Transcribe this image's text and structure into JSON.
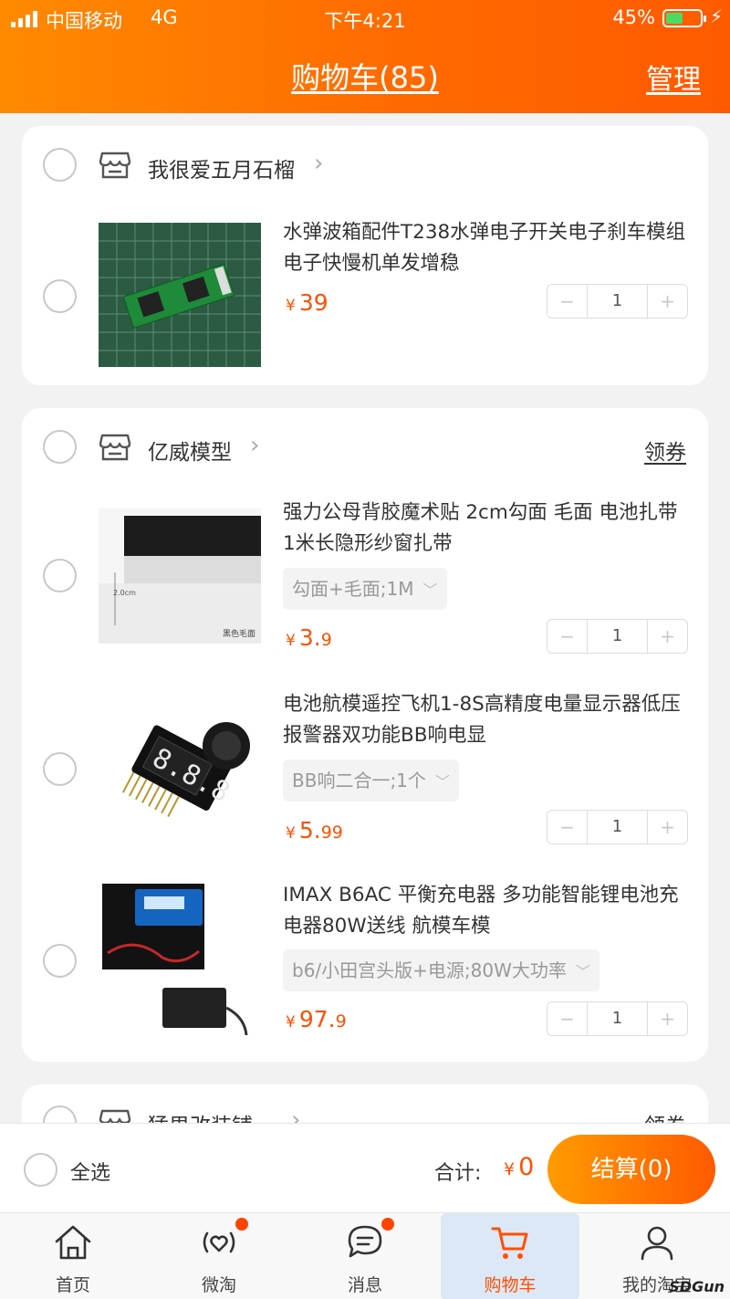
{
  "status_bar": {
    "carrier": "中国移动",
    "network": "4G",
    "time": "下午4:21",
    "battery": "45%"
  },
  "header": {
    "title": "购物车(85)",
    "manage": "管理"
  },
  "stores": [
    {
      "name": "我很爱五月石榴",
      "coupon": "",
      "items": [
        {
          "title": "水弹波箱配件T238水弹电子开关电子刹车模组电子快慢机单发增稳",
          "sku": "",
          "price_currency": "¥",
          "price_int": "39",
          "price_dec": "",
          "qty": "1"
        }
      ]
    },
    {
      "name": "亿威模型",
      "coupon": "领券",
      "items": [
        {
          "title": "强力公母背胶魔术贴 2cm勾面 毛面 电池扎带 1米长隐形纱窗扎带",
          "sku": "勾面+毛面;1M",
          "price_currency": "¥",
          "price_int": "3.",
          "price_dec": "9",
          "qty": "1",
          "thumb_caption_1": "2.0cm",
          "thumb_caption_2": "黑色毛面"
        },
        {
          "title": "电池航模遥控飞机1-8S高精度电量显示器低压报警器双功能BB响电显",
          "sku": "BB响二合一;1个",
          "price_currency": "¥",
          "price_int": "5.",
          "price_dec": "99",
          "qty": "1",
          "thumb_digits": "8.8.8"
        },
        {
          "title": "IMAX B6AC 平衡充电器 多功能智能锂电池充电器80W送线 航模车模",
          "sku": "b6/小田宫头版+电源;80W大功率",
          "price_currency": "¥",
          "price_int": "97.",
          "price_dec": "9",
          "qty": "1"
        }
      ]
    },
    {
      "name": "猛男改装铺",
      "coupon": "领券"
    }
  ],
  "stepper": {
    "minus": "−",
    "plus": "+"
  },
  "checkout": {
    "select_all": "全选",
    "total_label": "合计:",
    "total_currency": "¥",
    "total_value": "0",
    "pay_button": "结算(0)"
  },
  "tabs": [
    {
      "label": "首页",
      "icon": "home-icon"
    },
    {
      "label": "微淘",
      "icon": "heart-signal-icon"
    },
    {
      "label": "消息",
      "icon": "message-icon"
    },
    {
      "label": "购物车",
      "icon": "cart-icon"
    },
    {
      "label": "我的淘宝",
      "icon": "profile-icon"
    }
  ],
  "watermark": "SDGun",
  "colors": {
    "accent": "#ff5000",
    "header_start": "#ff8a00",
    "header_end": "#ff5a00",
    "active_tab_bg": "#dde8f7",
    "badge": "#ff4400"
  }
}
